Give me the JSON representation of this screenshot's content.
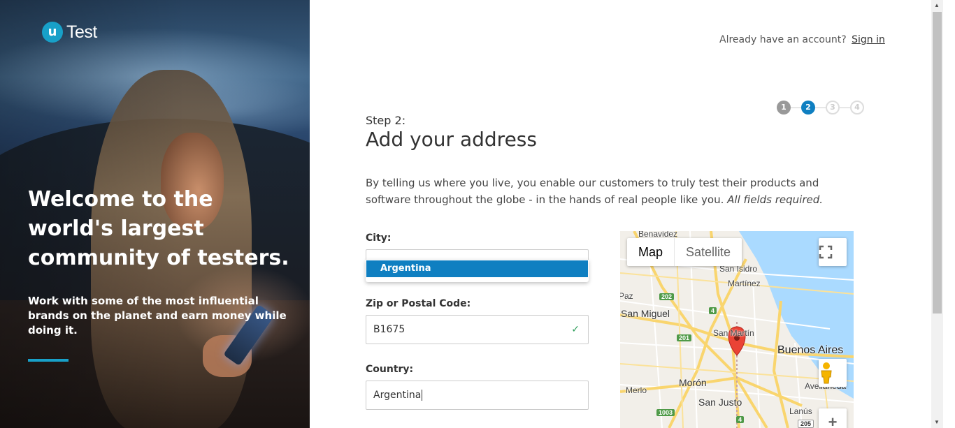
{
  "brand": {
    "logo_mark": "u",
    "logo_text": "Test"
  },
  "hero": {
    "title": "Welcome to the world's largest community of testers.",
    "subtitle": "Work with some of the most influential brands on the planet and earn money while doing it."
  },
  "header": {
    "account_prompt": "Already have an account?",
    "sign_in": "Sign in"
  },
  "stepper": {
    "steps": [
      "1",
      "2",
      "3",
      "4"
    ],
    "current": 2
  },
  "form": {
    "step_label": "Step 2:",
    "title": "Add your address",
    "intro": "By telling us where you live, you enable our customers to truly test their products and software throughout the globe - in the hands of real people like you.",
    "intro_emphasis": "All fields required.",
    "city": {
      "label": "City:",
      "value": "",
      "suggestion": "Argentina"
    },
    "zip": {
      "label": "Zip or Postal Code:",
      "value": "B1675",
      "valid_icon": "check-icon"
    },
    "country": {
      "label": "Country:",
      "value": "Argentina"
    }
  },
  "map": {
    "type_options": [
      "Map",
      "Satellite"
    ],
    "selected_type": "Map",
    "labels": [
      "Benavidez",
      "San Isidro",
      "Martínez",
      "San Miguel",
      "San Martín",
      "Buenos Aires",
      "Merlo",
      "Morón",
      "San Justo",
      "Avellaneda",
      "Lanús",
      "Paz"
    ],
    "route_badges": [
      "202",
      "4",
      "201",
      "1003",
      "4",
      "205"
    ],
    "colors": {
      "water": "#aadaff",
      "land": "#f2efe9",
      "roads": "#f9d56e",
      "pin": "#ea4335"
    }
  },
  "colors": {
    "accent": "#0f7fc1",
    "brand": "#18a0c8",
    "valid": "#2e9e5b"
  }
}
